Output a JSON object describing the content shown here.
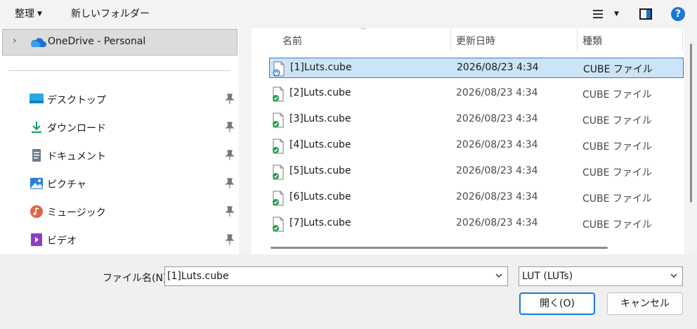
{
  "toolbar": {
    "organize_label": "整理",
    "new_folder_label": "新しいフォルダー",
    "help_label": "?"
  },
  "nav": {
    "onedrive_label": "OneDrive - Personal",
    "quick_access": [
      {
        "label": "デスクトップ",
        "icon": "desktop-icon",
        "color": "#2aa7e6"
      },
      {
        "label": "ダウンロード",
        "icon": "download-icon",
        "color": "#1a9c5a"
      },
      {
        "label": "ドキュメント",
        "icon": "document-icon",
        "color": "#6d7b8d"
      },
      {
        "label": "ピクチャ",
        "icon": "pictures-icon",
        "color": "#2a7fd4"
      },
      {
        "label": "ミュージック",
        "icon": "music-icon",
        "color": "#e0654a"
      },
      {
        "label": "ビデオ",
        "icon": "video-icon",
        "color": "#8a3ec6"
      }
    ]
  },
  "columns": {
    "name": "名前",
    "date": "更新日時",
    "type": "種類"
  },
  "files": [
    {
      "name": "[1]Luts.cube",
      "date": "2026/08/23 4:34",
      "type": "CUBE ファイル",
      "selected": true
    },
    {
      "name": "[2]Luts.cube",
      "date": "2026/08/23 4:34",
      "type": "CUBE ファイル"
    },
    {
      "name": "[3]Luts.cube",
      "date": "2026/08/23 4:34",
      "type": "CUBE ファイル"
    },
    {
      "name": "[4]Luts.cube",
      "date": "2026/08/23 4:34",
      "type": "CUBE ファイル"
    },
    {
      "name": "[5]Luts.cube",
      "date": "2026/08/23 4:34",
      "type": "CUBE ファイル"
    },
    {
      "name": "[6]Luts.cube",
      "date": "2026/08/23 4:34",
      "type": "CUBE ファイル"
    },
    {
      "name": "[7]Luts.cube",
      "date": "2026/08/23 4:34",
      "type": "CUBE ファイル"
    }
  ],
  "bottom": {
    "filename_label": "ファイル名(N):",
    "filename_value": "[1]Luts.cube",
    "filetype_value": "LUT (LUTs)",
    "open_label": "開く(O)",
    "cancel_label": "キャンセル"
  },
  "colors": {
    "accent": "#1a78d6",
    "selection": "#cce4f7",
    "sync_badge": "#1e9e4a"
  }
}
